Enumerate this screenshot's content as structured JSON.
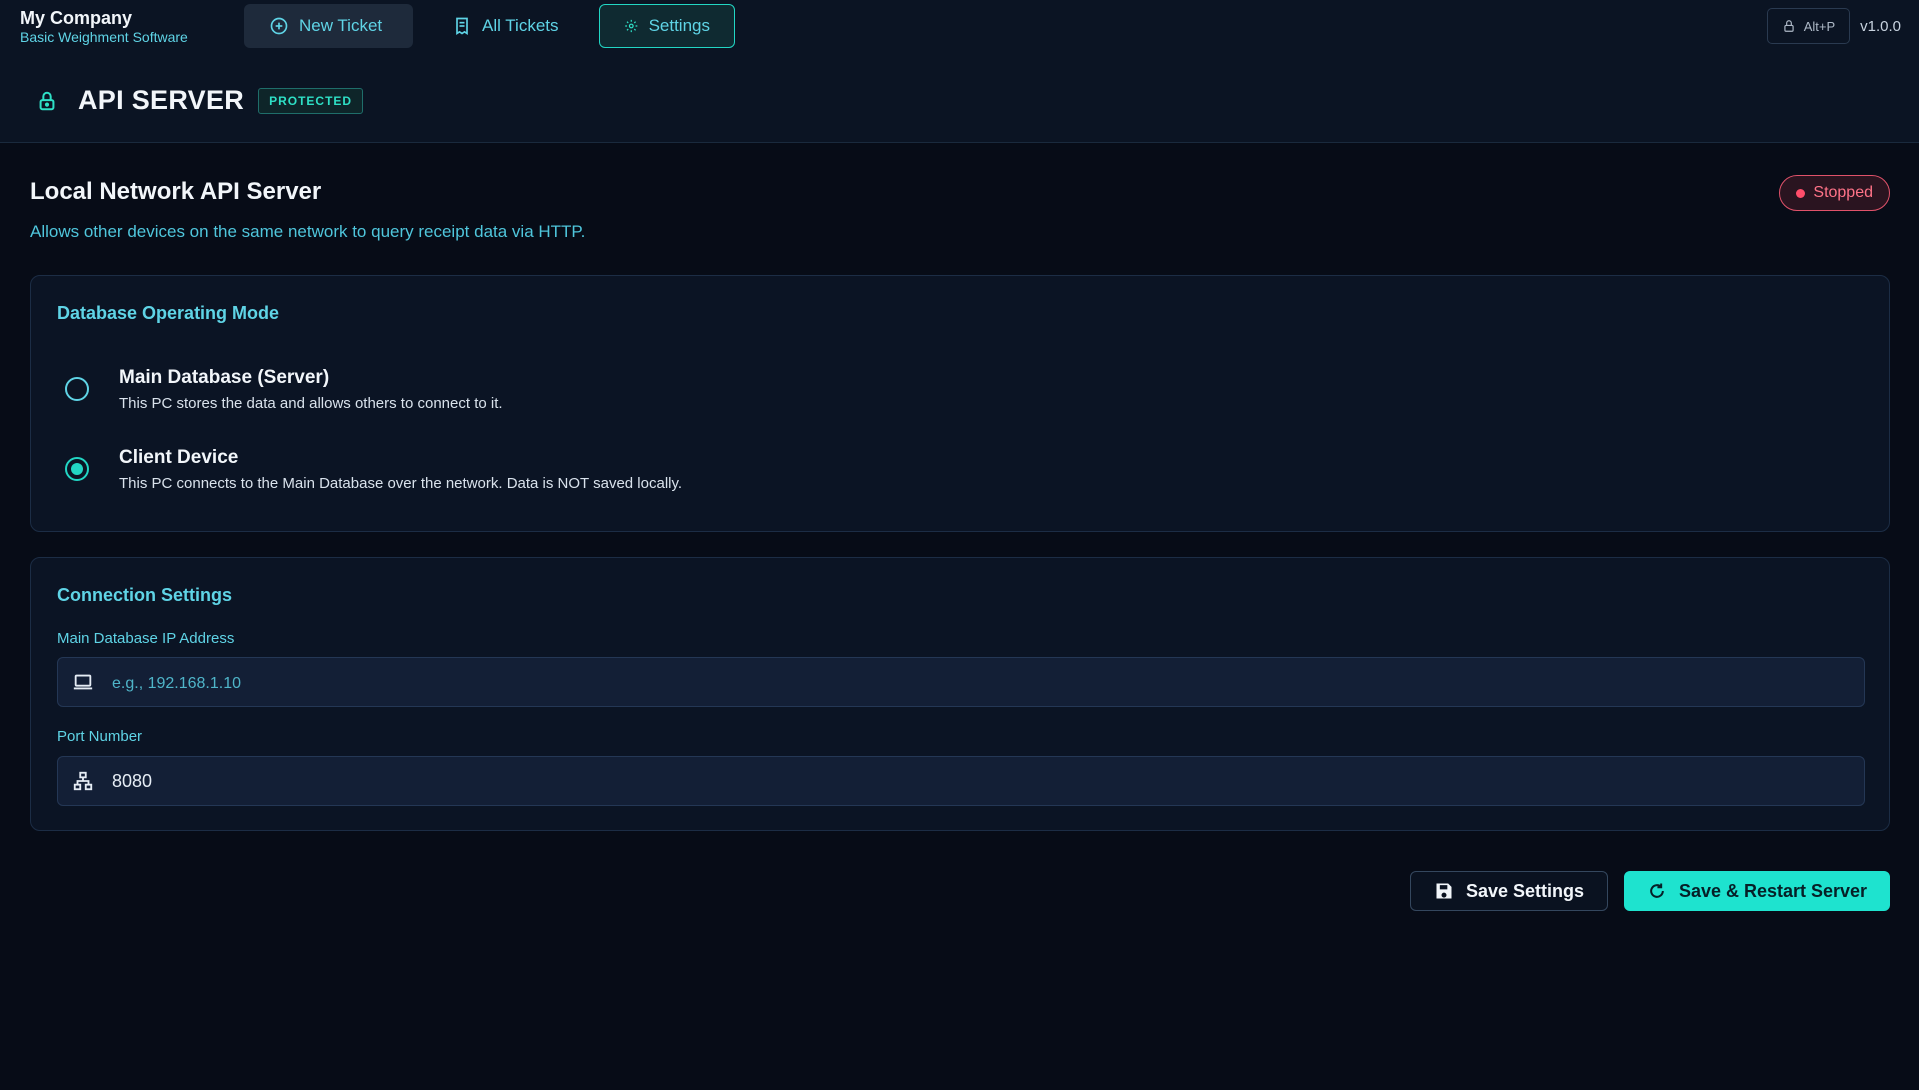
{
  "brand": {
    "name": "My Company",
    "subtitle": "Basic Weighment Software"
  },
  "nav": {
    "new_ticket": "New Ticket",
    "all_tickets": "All Tickets",
    "settings": "Settings"
  },
  "top_right": {
    "shortcut": "Alt+P",
    "version": "v1.0.0"
  },
  "page": {
    "title": "API SERVER",
    "badge": "PROTECTED"
  },
  "section": {
    "title": "Local Network API Server",
    "description": "Allows other devices on the same network to query receipt data via HTTP.",
    "status": "Stopped"
  },
  "mode": {
    "title": "Database Operating Mode",
    "options": [
      {
        "label": "Main Database (Server)",
        "description": "This PC stores the data and allows others to connect to it.",
        "selected": false
      },
      {
        "label": "Client Device",
        "description": "This PC connects to the Main Database over the network. Data is NOT saved locally.",
        "selected": true
      }
    ]
  },
  "connection": {
    "title": "Connection Settings",
    "ip_label": "Main Database IP Address",
    "ip_placeholder": "e.g., 192.168.1.10",
    "ip_value": "",
    "port_label": "Port Number",
    "port_value": "8080"
  },
  "actions": {
    "save": "Save Settings",
    "restart": "Save & Restart Server"
  },
  "colors": {
    "accent": "#22d6c4",
    "status_stopped": "#ff4d6a",
    "background": "#070c17"
  },
  "icons": {
    "new_ticket": "plus-circle-icon",
    "all_tickets": "receipt-icon",
    "settings": "gear-icon",
    "shortcut": "lock-icon",
    "page": "lock-icon",
    "ip": "laptop-icon",
    "port": "network-icon",
    "save": "floppy-disk-icon",
    "restart": "refresh-icon"
  }
}
